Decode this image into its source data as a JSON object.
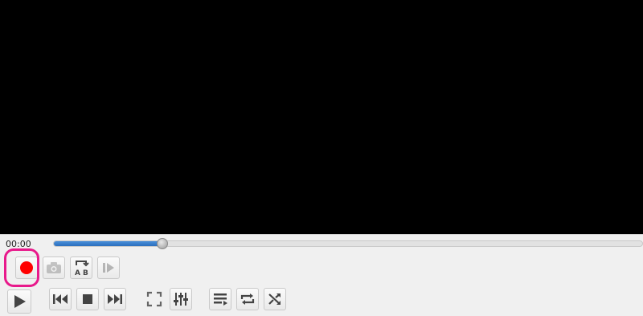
{
  "player": {
    "time_elapsed": "00:00",
    "seek_progress": 0.185
  },
  "colors": {
    "record": "#ff0000",
    "seek_fill": "#2c6fbe",
    "highlight": "#e8198b",
    "video_bg": "#000000"
  },
  "advanced_controls": [
    {
      "name": "record-button",
      "icon": "record-icon"
    },
    {
      "name": "snapshot-button",
      "icon": "camera-icon"
    },
    {
      "name": "ab-loop-button",
      "icon": "ab-loop-icon",
      "text": "A B"
    },
    {
      "name": "frame-step-button",
      "icon": "frame-step-icon"
    }
  ],
  "main_controls": [
    {
      "name": "play-button",
      "icon": "play-icon"
    },
    {
      "name": "previous-button",
      "icon": "skip-previous-icon"
    },
    {
      "name": "stop-button",
      "icon": "stop-icon"
    },
    {
      "name": "next-button",
      "icon": "skip-next-icon"
    },
    {
      "name": "fullscreen-button",
      "icon": "fullscreen-icon"
    },
    {
      "name": "extended-settings-button",
      "icon": "equalizer-sliders-icon"
    },
    {
      "name": "playlist-button",
      "icon": "playlist-icon"
    },
    {
      "name": "loop-button",
      "icon": "repeat-icon"
    },
    {
      "name": "shuffle-button",
      "icon": "shuffle-icon"
    }
  ]
}
